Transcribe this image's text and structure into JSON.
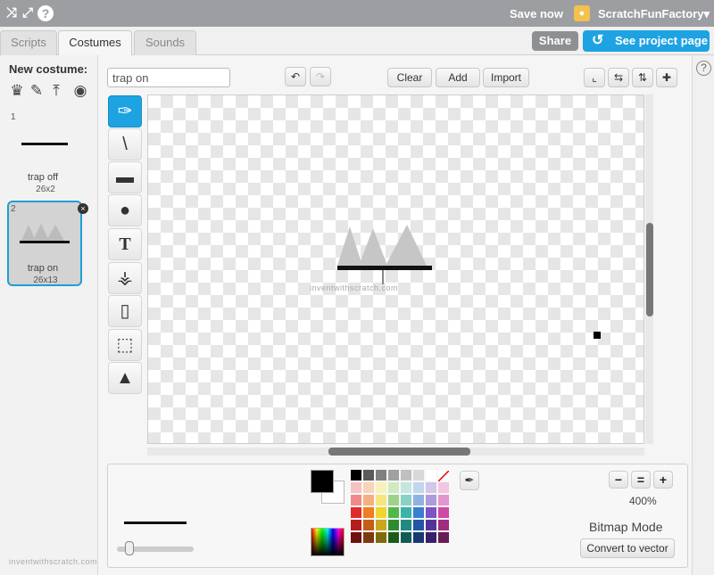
{
  "topbar": {
    "save_label": "Save now",
    "username": "ScratchFunFactory▾",
    "icons": [
      "collapse-icon",
      "fullscreen-icon",
      "help-icon",
      "user-icon"
    ]
  },
  "tabs": [
    {
      "label": "Scripts"
    },
    {
      "label": "Costumes"
    },
    {
      "label": "Sounds"
    }
  ],
  "header_buttons": {
    "share": "Share",
    "see_project": "See project page"
  },
  "costume_pane": {
    "title": "New costume:",
    "tools": [
      "choose-from-library-icon",
      "paint-new-icon",
      "upload-icon",
      "camera-icon"
    ],
    "costumes": [
      {
        "index": "1",
        "name": "trap off",
        "size": "26x2"
      },
      {
        "index": "2",
        "name": "trap on",
        "size": "26x13",
        "selected": true
      }
    ]
  },
  "editor": {
    "costume_name": "trap on",
    "clear": "Clear",
    "add": "Add",
    "import": "Import",
    "tools": [
      "brush-icon",
      "line-icon",
      "rectangle-icon",
      "ellipse-icon",
      "text-icon",
      "fill-icon",
      "eraser-icon",
      "select-icon",
      "stamp-icon"
    ],
    "selected_tool": "brush-icon",
    "watermark": "inventwithscratch.com"
  },
  "bottom": {
    "zoom": "400%",
    "mode": "Bitmap Mode",
    "convert": "Convert to vector",
    "colors": {
      "primary": "#000000",
      "secondary": "#ffffff",
      "palette": [
        "#000000",
        "#5a5a5a",
        "#808080",
        "#a0a0a0",
        "#c0c0c0",
        "#d8d8d8",
        "#ffffff",
        "#ff0000",
        "#f6c1c1",
        "#f7d4b8",
        "#f9f1b8",
        "#cfe9c2",
        "#c4e6e1",
        "#c1d5ee",
        "#d2c6ea",
        "#f0c6e2",
        "#f08a8a",
        "#f4b082",
        "#f5e67d",
        "#9ed28c",
        "#8bd0c6",
        "#8eb3e0",
        "#ae9bdb",
        "#e296cb",
        "#e12b2b",
        "#f07d1f",
        "#f1d62c",
        "#50b847",
        "#3bb3a9",
        "#3a7ed0",
        "#7a55c5",
        "#d04aa5",
        "#b71c1c",
        "#c45d15",
        "#c8a917",
        "#2d8c2f",
        "#1e8a80",
        "#2056a6",
        "#55349a",
        "#a12b7e",
        "#6e1010",
        "#7d3a0e",
        "#7e6b0d",
        "#1b5c1c",
        "#135c55",
        "#163a70",
        "#38216a",
        "#6a1c54"
      ]
    }
  },
  "watermark_bottom": "inventwithscratch.com"
}
